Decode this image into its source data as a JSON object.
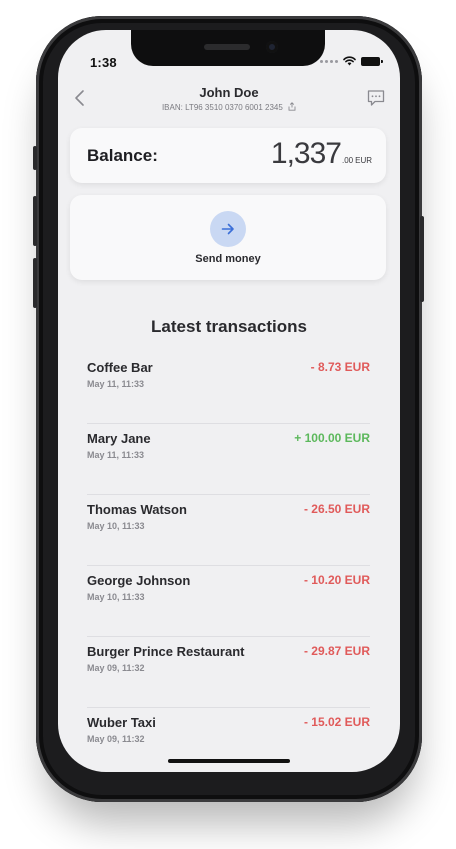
{
  "status_bar": {
    "time": "1:38"
  },
  "header": {
    "user_name": "John Doe",
    "iban": "IBAN: LT96 3510 0370 6001 2345"
  },
  "balance": {
    "label": "Balance:",
    "integer": "1,337",
    "decimal": ".00",
    "currency": "EUR"
  },
  "send_money": {
    "label": "Send money"
  },
  "transactions": {
    "title": "Latest transactions",
    "items": [
      {
        "name": "Coffee Bar",
        "date": "May 11, 11:33",
        "amount": "- 8.73 EUR",
        "type": "neg"
      },
      {
        "name": "Mary Jane",
        "date": "May 11, 11:33",
        "amount": "+ 100.00 EUR",
        "type": "pos"
      },
      {
        "name": "Thomas Watson",
        "date": "May 10, 11:33",
        "amount": "- 26.50 EUR",
        "type": "neg"
      },
      {
        "name": "George Johnson",
        "date": "May 10, 11:33",
        "amount": "- 10.20 EUR",
        "type": "neg"
      },
      {
        "name": "Burger Prince Restaurant",
        "date": "May 09, 11:32",
        "amount": "- 29.87 EUR",
        "type": "neg"
      },
      {
        "name": "Wuber Taxi",
        "date": "May 09, 11:32",
        "amount": "- 15.02 EUR",
        "type": "neg"
      }
    ]
  },
  "colors": {
    "negative": "#e05a5a",
    "positive": "#5cb85c",
    "accent": "#3b6fd8",
    "accent_bg": "#c9d8f3"
  },
  "icons": {
    "back": "chevron-left-icon",
    "share": "share-icon",
    "chat": "chat-bubble-icon",
    "send": "arrow-right-icon",
    "wifi": "wifi-icon",
    "battery": "battery-icon"
  }
}
